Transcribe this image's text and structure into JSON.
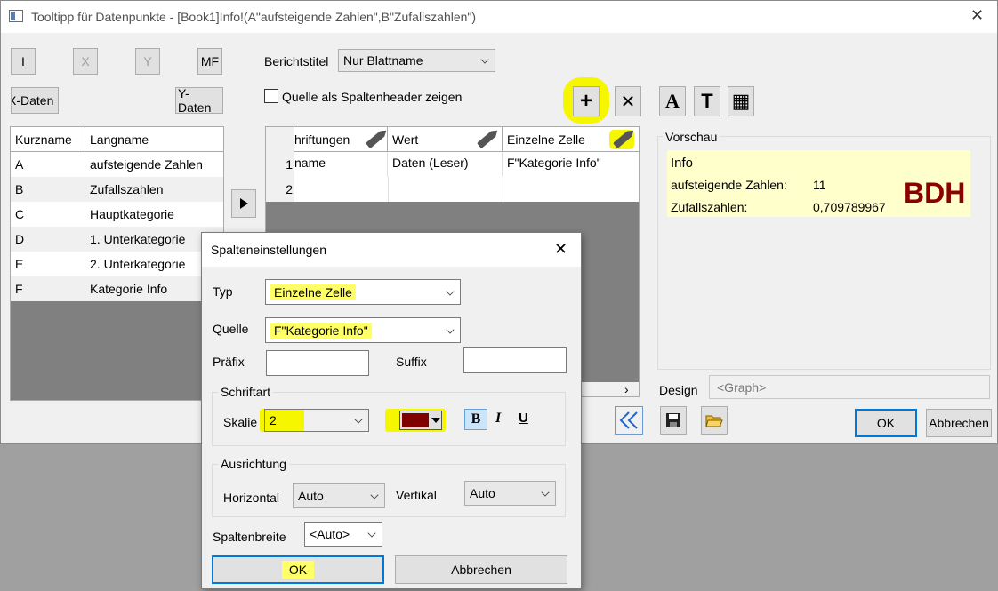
{
  "window": {
    "title": "Tooltipp für Datenpunkte - [Book1]Info!(A\"aufsteigende Zahlen\",B\"Zufallszahlen\")",
    "close_glyph": "✕"
  },
  "left_toolbar": {
    "btn_i": "I",
    "btn_x": "X",
    "btn_y": "Y",
    "btn_mf": "MF",
    "x_data": "X-Daten",
    "y_data": "Y-Daten"
  },
  "columns_list": {
    "headers": [
      "Kurzname",
      "Langname"
    ],
    "rows": [
      {
        "short": "A",
        "long": "aufsteigende Zahlen"
      },
      {
        "short": "B",
        "long": "Zufallszahlen"
      },
      {
        "short": "C",
        "long": "Hauptkategorie"
      },
      {
        "short": "D",
        "long": "1. Unterkategorie"
      },
      {
        "short": "E",
        "long": "2. Unterkategorie"
      },
      {
        "short": "F",
        "long": "Kategorie Info"
      }
    ]
  },
  "report": {
    "title_label": "Berichtstitel",
    "title_value": "Nur Blattname",
    "source_header_label": "Quelle als Spaltenheader zeigen",
    "source_header_checked": false
  },
  "grid": {
    "headers": [
      "hriftungen",
      "Wert",
      "Einzelne Zelle"
    ],
    "rows": [
      {
        "num": "1",
        "c1": "name",
        "c2": "Daten (Leser)",
        "c3": "F\"Kategorie Info\""
      },
      {
        "num": "2",
        "c1": "",
        "c2": "",
        "c3": ""
      }
    ]
  },
  "toolbar_icons": {
    "add": "+",
    "delete": "✕",
    "font": "A",
    "text": "T",
    "table": "▦"
  },
  "preview": {
    "label": "Vorschau",
    "line1": "Info",
    "line2_label": "aufsteigende Zahlen:",
    "line2_value": "11",
    "line3_label": "Zufallszahlen:",
    "line3_value": "0,709789967",
    "big_text": "BDH",
    "big_color": "#8b0000",
    "bg_color": "#ffffcc"
  },
  "design": {
    "label": "Design",
    "placeholder": "<Graph>"
  },
  "main_buttons": {
    "ok": "OK",
    "cancel": "Abbrechen"
  },
  "dialog": {
    "title": "Spalteneinstellungen",
    "type_label": "Typ",
    "type_value": "Einzelne Zelle",
    "source_label": "Quelle",
    "source_value": "F\"Kategorie Info\"",
    "prefix_label": "Präfix",
    "suffix_label": "Suffix",
    "font_group": "Schriftart",
    "scale_label": "Skalie",
    "scale_value": "2",
    "font_color": "#800000",
    "bold": "B",
    "italic": "I",
    "underline": "U",
    "align_group": "Ausrichtung",
    "horizontal_label": "Horizontal",
    "horizontal_value": "Auto",
    "vertical_label": "Vertikal",
    "vertical_value": "Auto",
    "col_width_label": "Spaltenbreite",
    "col_width_value": "<Auto>",
    "ok": "OK",
    "cancel": "Abbrechen"
  },
  "colors": {
    "highlight": "#f6f600",
    "accent_blue": "#0078d7"
  }
}
